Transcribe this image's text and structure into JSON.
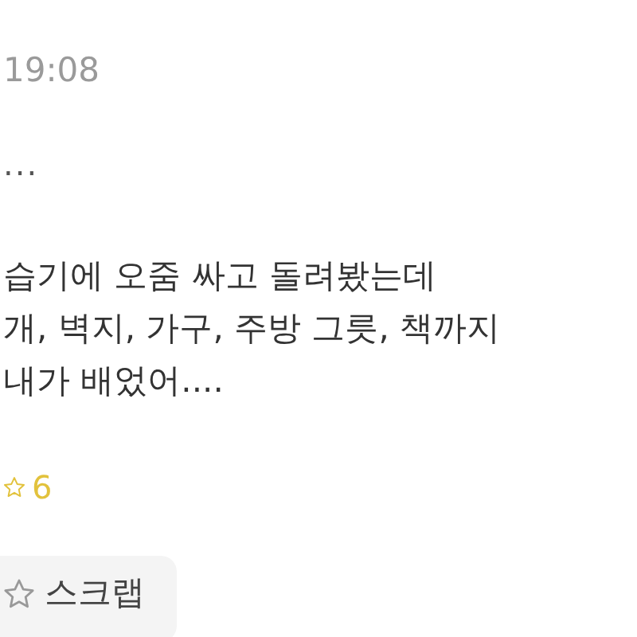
{
  "post": {
    "time": "19:08",
    "preview": "...",
    "body_lines": [
      "습기에 오줌 싸고 돌려봤는데",
      "개, 벽지, 가구, 주방 그릇, 책까지",
      "내가 배었어...."
    ],
    "like_count": "6",
    "scrap_button": {
      "label": "스크랩"
    }
  }
}
